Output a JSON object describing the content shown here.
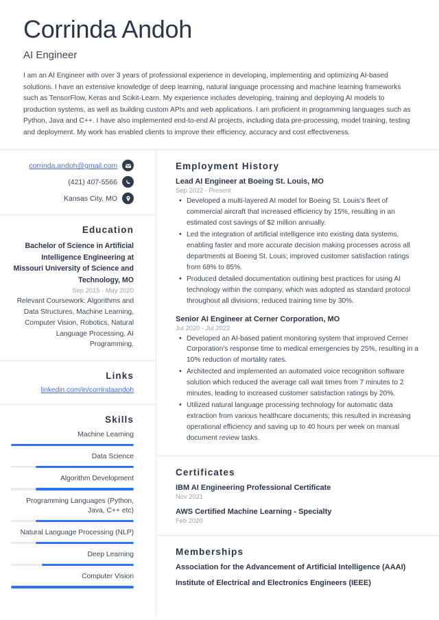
{
  "theme": {
    "accent_blue": "#2d73f5",
    "link_blue": "#4a6ee0",
    "heading_navy": "#2b3648",
    "body_text": "#3a4657",
    "muted_date": "#9aa1ac",
    "divider": "#e6e7ea",
    "icon_circle": "#2e3a4e",
    "track_gray": "#e9eaec",
    "background": "#ffffff"
  },
  "header": {
    "full_name": "Corrinda Andoh",
    "job_title": "AI Engineer",
    "summary": "I am an AI Engineer with over 3 years of professional experience in developing, implementing and optimizing AI-based solutions. I have an extensive knowledge of deep learning, natural language processing and machine learning frameworks such as TensorFlow, Keras and Scikit-Learn. My experience includes developing, training and deploying AI models to production systems, as well as building custom APIs and web applications. I am proficient in programming languages such as Python, Java and C++. I have also implemented end-to-end AI projects, including data pre-processing, model training, testing and deployment. My work has enabled clients to improve their efficiency, accuracy and cost effectiveness."
  },
  "contact": {
    "email": {
      "value": "corrinda.andoh@gmail.com",
      "icon": "envelope-icon"
    },
    "phone": {
      "value": "(421) 407-5566",
      "icon": "phone-icon"
    },
    "location": {
      "value": "Kansas City, MO",
      "icon": "map-pin-icon"
    }
  },
  "education": {
    "heading": "Education",
    "degree": "Bachelor of Science in Artificial Intelligence Engineering at Missouri University of Science and Technology, MO",
    "date": "Sep 2015 - May 2020",
    "description": "Relevant Coursework: Algorithms and Data Structures, Machine Learning, Computer Vision, Robotics, Natural Language Processing, AI Programming."
  },
  "links": {
    "heading": "Links",
    "items": [
      {
        "label": "linkedin.com/in/corrindaandoh"
      }
    ]
  },
  "skills": {
    "heading": "Skills",
    "items": [
      {
        "label": "Machine Learning",
        "level": 100
      },
      {
        "label": "Data Science",
        "level": 80
      },
      {
        "label": "Algorithm Development",
        "level": 80
      },
      {
        "label": "Programming Languages (Python, Java, C++ etc)",
        "level": 80
      },
      {
        "label": "Natural Language Processing (NLP)",
        "level": 80
      },
      {
        "label": "Deep Learning",
        "level": 75
      },
      {
        "label": "Computer Vision",
        "level": 100
      }
    ]
  },
  "employment": {
    "heading": "Employment History",
    "jobs": [
      {
        "role": "Lead AI Engineer at Boeing St. Louis, MO",
        "date": "Sep 2022 - Present",
        "bullets": [
          "Developed a multi-layered AI model for Boeing St. Louis’s fleet of commercial aircraft that increased efficiency by 15%, resulting in an estimated cost savings of $2 million annually.",
          "Led the integration of artificial intelligence into existing data systems, enabling faster and more accurate decision making processes across all departments at Boeing St. Louis; improved customer satisfaction ratings from 68% to 85%.",
          "Produced detailed documentation outlining best practices for using AI technology within the company, which was adopted as standard protocol throughout all divisions; reduced training time by 30%."
        ]
      },
      {
        "role": "Senior AI Engineer at Cerner Corporation, MO",
        "date": "Jul 2020 - Jul 2022",
        "bullets": [
          "Developed an AI-based patient monitoring system that improved Cerner Corporation’s response time to medical emergencies by 25%, resulting in a 10% reduction of mortality rates.",
          "Architected and implemented an automated voice recognition software solution which reduced the average call wait times from 7 minutes to 2 minutes, leading to increased customer satisfaction ratings by 20%.",
          "Utilized natural language processing technology for automatic data extraction from various healthcare documents; this resulted in increasing operational efficiency and saving up to 40 hours per week on manual document review tasks."
        ]
      }
    ]
  },
  "certificates": {
    "heading": "Certificates",
    "items": [
      {
        "name": "IBM AI Engineering Professional Certificate",
        "date": "Nov 2021"
      },
      {
        "name": "AWS Certified Machine Learning - Specialty",
        "date": "Feb 2020"
      }
    ]
  },
  "memberships": {
    "heading": "Memberships",
    "items": [
      {
        "name": "Association for the Advancement of Artificial Intelligence (AAAI)"
      },
      {
        "name": "Institute of Electrical and Electronics Engineers (IEEE)"
      }
    ]
  }
}
